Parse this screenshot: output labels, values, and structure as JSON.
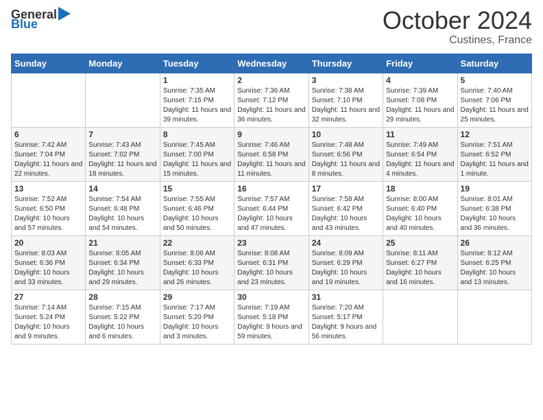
{
  "header": {
    "logo_general": "General",
    "logo_blue": "Blue",
    "month": "October 2024",
    "location": "Custines, France"
  },
  "calendar": {
    "weekdays": [
      "Sunday",
      "Monday",
      "Tuesday",
      "Wednesday",
      "Thursday",
      "Friday",
      "Saturday"
    ],
    "weeks": [
      [
        {
          "day": "",
          "sunrise": "",
          "sunset": "",
          "daylight": ""
        },
        {
          "day": "",
          "sunrise": "",
          "sunset": "",
          "daylight": ""
        },
        {
          "day": "1",
          "sunrise": "Sunrise: 7:35 AM",
          "sunset": "Sunset: 7:15 PM",
          "daylight": "Daylight: 11 hours and 39 minutes."
        },
        {
          "day": "2",
          "sunrise": "Sunrise: 7:36 AM",
          "sunset": "Sunset: 7:12 PM",
          "daylight": "Daylight: 11 hours and 36 minutes."
        },
        {
          "day": "3",
          "sunrise": "Sunrise: 7:38 AM",
          "sunset": "Sunset: 7:10 PM",
          "daylight": "Daylight: 11 hours and 32 minutes."
        },
        {
          "day": "4",
          "sunrise": "Sunrise: 7:39 AM",
          "sunset": "Sunset: 7:08 PM",
          "daylight": "Daylight: 11 hours and 29 minutes."
        },
        {
          "day": "5",
          "sunrise": "Sunrise: 7:40 AM",
          "sunset": "Sunset: 7:06 PM",
          "daylight": "Daylight: 11 hours and 25 minutes."
        }
      ],
      [
        {
          "day": "6",
          "sunrise": "Sunrise: 7:42 AM",
          "sunset": "Sunset: 7:04 PM",
          "daylight": "Daylight: 11 hours and 22 minutes."
        },
        {
          "day": "7",
          "sunrise": "Sunrise: 7:43 AM",
          "sunset": "Sunset: 7:02 PM",
          "daylight": "Daylight: 11 hours and 18 minutes."
        },
        {
          "day": "8",
          "sunrise": "Sunrise: 7:45 AM",
          "sunset": "Sunset: 7:00 PM",
          "daylight": "Daylight: 11 hours and 15 minutes."
        },
        {
          "day": "9",
          "sunrise": "Sunrise: 7:46 AM",
          "sunset": "Sunset: 6:58 PM",
          "daylight": "Daylight: 11 hours and 11 minutes."
        },
        {
          "day": "10",
          "sunrise": "Sunrise: 7:48 AM",
          "sunset": "Sunset: 6:56 PM",
          "daylight": "Daylight: 11 hours and 8 minutes."
        },
        {
          "day": "11",
          "sunrise": "Sunrise: 7:49 AM",
          "sunset": "Sunset: 6:54 PM",
          "daylight": "Daylight: 11 hours and 4 minutes."
        },
        {
          "day": "12",
          "sunrise": "Sunrise: 7:51 AM",
          "sunset": "Sunset: 6:52 PM",
          "daylight": "Daylight: 11 hours and 1 minute."
        }
      ],
      [
        {
          "day": "13",
          "sunrise": "Sunrise: 7:52 AM",
          "sunset": "Sunset: 6:50 PM",
          "daylight": "Daylight: 10 hours and 57 minutes."
        },
        {
          "day": "14",
          "sunrise": "Sunrise: 7:54 AM",
          "sunset": "Sunset: 6:48 PM",
          "daylight": "Daylight: 10 hours and 54 minutes."
        },
        {
          "day": "15",
          "sunrise": "Sunrise: 7:55 AM",
          "sunset": "Sunset: 6:46 PM",
          "daylight": "Daylight: 10 hours and 50 minutes."
        },
        {
          "day": "16",
          "sunrise": "Sunrise: 7:57 AM",
          "sunset": "Sunset: 6:44 PM",
          "daylight": "Daylight: 10 hours and 47 minutes."
        },
        {
          "day": "17",
          "sunrise": "Sunrise: 7:58 AM",
          "sunset": "Sunset: 6:42 PM",
          "daylight": "Daylight: 10 hours and 43 minutes."
        },
        {
          "day": "18",
          "sunrise": "Sunrise: 8:00 AM",
          "sunset": "Sunset: 6:40 PM",
          "daylight": "Daylight: 10 hours and 40 minutes."
        },
        {
          "day": "19",
          "sunrise": "Sunrise: 8:01 AM",
          "sunset": "Sunset: 6:38 PM",
          "daylight": "Daylight: 10 hours and 36 minutes."
        }
      ],
      [
        {
          "day": "20",
          "sunrise": "Sunrise: 8:03 AM",
          "sunset": "Sunset: 6:36 PM",
          "daylight": "Daylight: 10 hours and 33 minutes."
        },
        {
          "day": "21",
          "sunrise": "Sunrise: 8:05 AM",
          "sunset": "Sunset: 6:34 PM",
          "daylight": "Daylight: 10 hours and 29 minutes."
        },
        {
          "day": "22",
          "sunrise": "Sunrise: 8:06 AM",
          "sunset": "Sunset: 6:33 PM",
          "daylight": "Daylight: 10 hours and 26 minutes."
        },
        {
          "day": "23",
          "sunrise": "Sunrise: 8:08 AM",
          "sunset": "Sunset: 6:31 PM",
          "daylight": "Daylight: 10 hours and 23 minutes."
        },
        {
          "day": "24",
          "sunrise": "Sunrise: 8:09 AM",
          "sunset": "Sunset: 6:29 PM",
          "daylight": "Daylight: 10 hours and 19 minutes."
        },
        {
          "day": "25",
          "sunrise": "Sunrise: 8:11 AM",
          "sunset": "Sunset: 6:27 PM",
          "daylight": "Daylight: 10 hours and 16 minutes."
        },
        {
          "day": "26",
          "sunrise": "Sunrise: 8:12 AM",
          "sunset": "Sunset: 6:25 PM",
          "daylight": "Daylight: 10 hours and 13 minutes."
        }
      ],
      [
        {
          "day": "27",
          "sunrise": "Sunrise: 7:14 AM",
          "sunset": "Sunset: 5:24 PM",
          "daylight": "Daylight: 10 hours and 9 minutes."
        },
        {
          "day": "28",
          "sunrise": "Sunrise: 7:15 AM",
          "sunset": "Sunset: 5:22 PM",
          "daylight": "Daylight: 10 hours and 6 minutes."
        },
        {
          "day": "29",
          "sunrise": "Sunrise: 7:17 AM",
          "sunset": "Sunset: 5:20 PM",
          "daylight": "Daylight: 10 hours and 3 minutes."
        },
        {
          "day": "30",
          "sunrise": "Sunrise: 7:19 AM",
          "sunset": "Sunset: 5:18 PM",
          "daylight": "Daylight: 9 hours and 59 minutes."
        },
        {
          "day": "31",
          "sunrise": "Sunrise: 7:20 AM",
          "sunset": "Sunset: 5:17 PM",
          "daylight": "Daylight: 9 hours and 56 minutes."
        },
        {
          "day": "",
          "sunrise": "",
          "sunset": "",
          "daylight": ""
        },
        {
          "day": "",
          "sunrise": "",
          "sunset": "",
          "daylight": ""
        }
      ]
    ]
  }
}
